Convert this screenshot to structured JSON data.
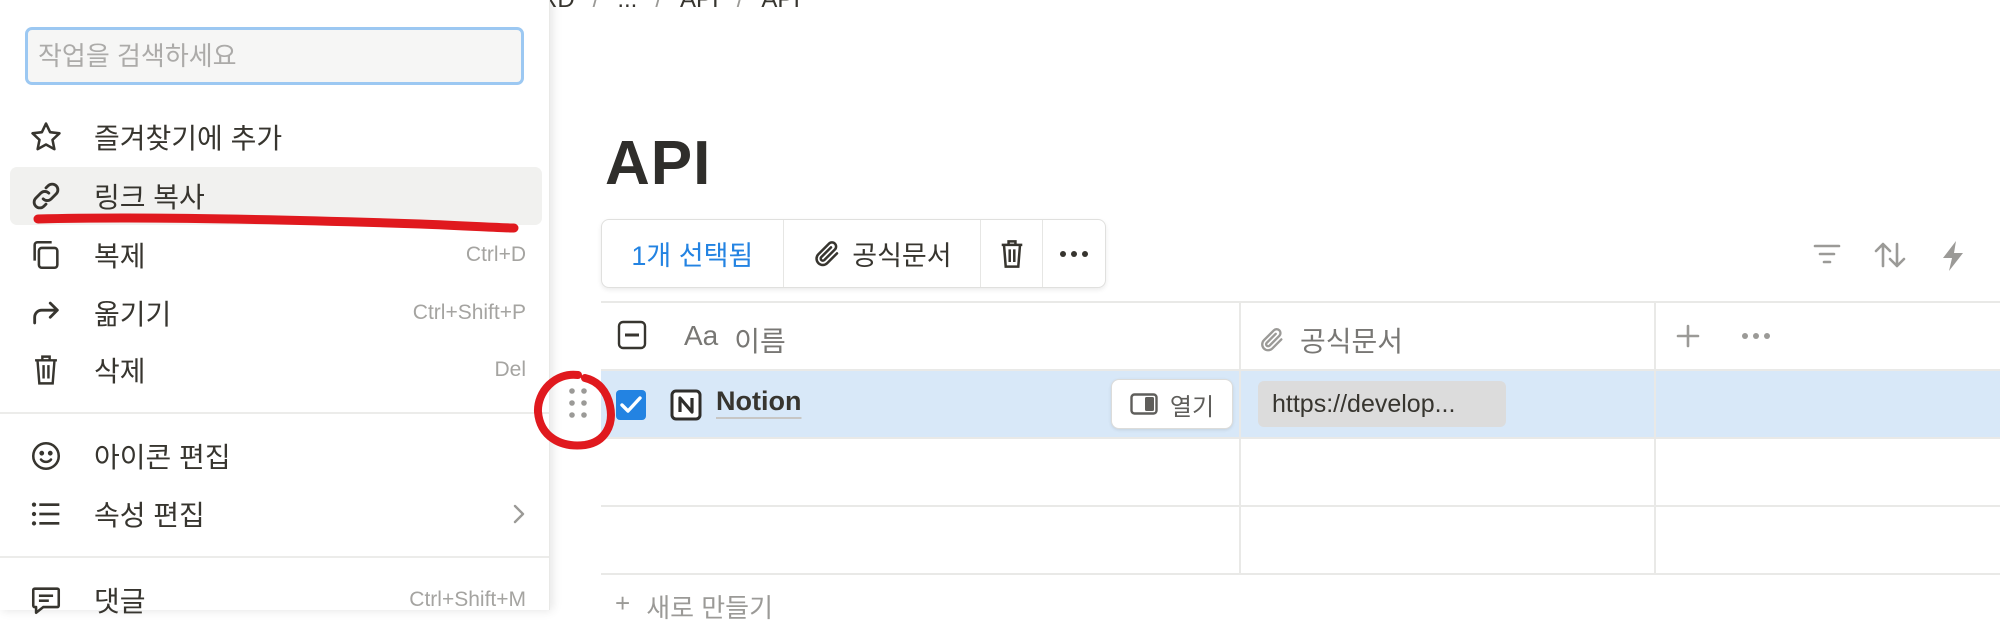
{
  "breadcrumb": [
    "RD",
    "...",
    "API",
    "API"
  ],
  "page": {
    "title": "API"
  },
  "action_bar": {
    "selected": "1개 선택됨",
    "filter_label": "공식문서"
  },
  "table": {
    "columns": [
      {
        "prefix": "Aa",
        "label": "이름",
        "icon": "text-icon"
      },
      {
        "label": "공식문서",
        "icon": "paperclip-icon"
      }
    ],
    "rows": [
      {
        "name": "Notion",
        "checked": true,
        "open_label": "열기",
        "url": "https://develop..."
      }
    ],
    "new_label": "새로 만들기"
  },
  "menu": {
    "search_placeholder": "작업을 검색하세요",
    "items": [
      {
        "label": "즐겨찾기에 추가",
        "icon": "star-icon",
        "shortcut": ""
      },
      {
        "label": "링크 복사",
        "icon": "link-icon",
        "shortcut": ""
      },
      {
        "label": "복제",
        "icon": "duplicate-icon",
        "shortcut": "Ctrl+D"
      },
      {
        "label": "옮기기",
        "icon": "move-icon",
        "shortcut": "Ctrl+Shift+P"
      },
      {
        "label": "삭제",
        "icon": "trash-icon",
        "shortcut": "Del"
      },
      {
        "label": "아이콘 편집",
        "icon": "smiley-icon",
        "shortcut": ""
      },
      {
        "label": "속성 편집",
        "icon": "list-icon",
        "shortcut": ""
      },
      {
        "label": "댓글",
        "icon": "comment-icon",
        "shortcut": "Ctrl+Shift+M"
      }
    ]
  },
  "colors": {
    "accent": "#2383e2",
    "selected_row": "#d8e8f8",
    "annotation": "#e0191e"
  }
}
